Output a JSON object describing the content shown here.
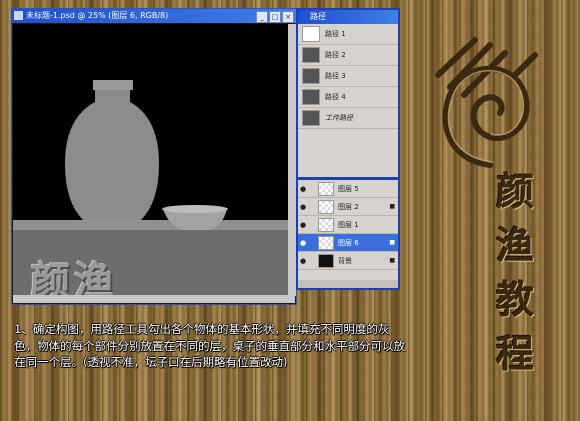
{
  "document": {
    "title": "未标题-1.psd @ 25% (图层 6, RGB/8)",
    "watermark": "颜渔"
  },
  "paths_panel": {
    "tab_label": "路径",
    "items": [
      {
        "label": "路径 1"
      },
      {
        "label": "路径 2"
      },
      {
        "label": "路径 3"
      },
      {
        "label": "路径 4"
      },
      {
        "label": "工作路径"
      }
    ]
  },
  "layers_panel": {
    "items": [
      {
        "label": "图层 5"
      },
      {
        "label": "图层 2"
      },
      {
        "label": "图层 1"
      },
      {
        "label": "图层 6",
        "selected": true
      },
      {
        "label": "背景"
      }
    ]
  },
  "sign": {
    "chars": [
      "颜",
      "渔",
      "教",
      "程"
    ]
  },
  "instruction": "1、确定构图，用路径工具勾出各个物体的基本形状，并填充不同明度的灰色，物体的每个部件分别放置在不同的层，桌子的垂直部分和水平部分可以放在同一个层。(透视不准，坛子口在后期略有位置改动)",
  "colors": {
    "title_bar": "#2a5fd8",
    "selected_layer": "#3b6fdc",
    "wood": "#a9864c"
  }
}
